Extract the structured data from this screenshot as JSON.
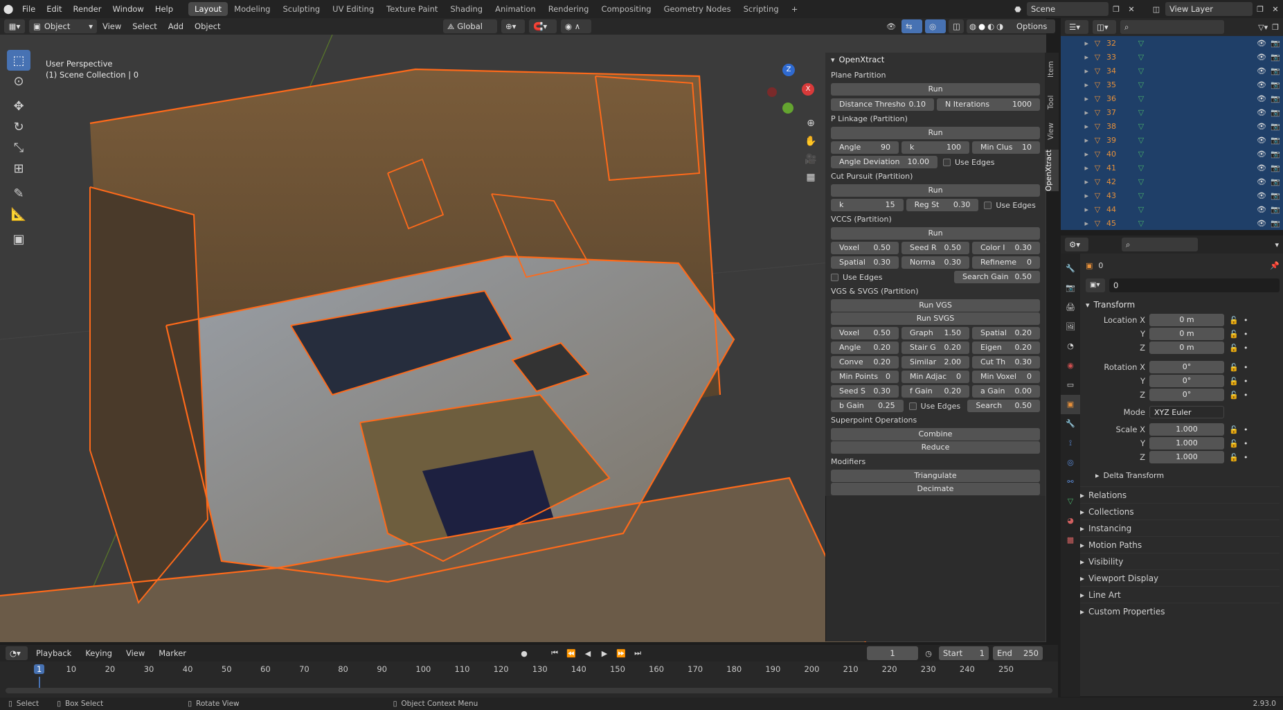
{
  "topbar": {
    "menus": [
      "File",
      "Edit",
      "Render",
      "Window",
      "Help"
    ],
    "workspaces": [
      "Layout",
      "Modeling",
      "Sculpting",
      "UV Editing",
      "Texture Paint",
      "Shading",
      "Animation",
      "Rendering",
      "Compositing",
      "Geometry Nodes",
      "Scripting"
    ],
    "active_workspace": "Layout",
    "scene": "Scene",
    "view_layer": "View Layer"
  },
  "viewport": {
    "mode": "Object Mode",
    "menus": [
      "View",
      "Select",
      "Add",
      "Object"
    ],
    "transform_orientation": "Global",
    "options_label": "Options",
    "overlay_title": "User Perspective",
    "overlay_sub": "(1) Scene Collection | 0"
  },
  "gizmo": {
    "z": "Z",
    "x": "X"
  },
  "npanel": {
    "tabs": [
      "Item",
      "Tool",
      "View",
      "OpenXtract"
    ],
    "title": "OpenXtract",
    "plane": {
      "heading": "Plane Partition",
      "run": "Run",
      "f1_label": "Distance Thresho",
      "f1_value": "0.10",
      "f2_label": "N Iterations",
      "f2_value": "1000"
    },
    "plink": {
      "heading": "P Linkage (Partition)",
      "run": "Run",
      "angle_l": "Angle",
      "angle_v": "90",
      "k_l": "k",
      "k_v": "100",
      "minclus_l": "Min Clus",
      "minclus_v": "10",
      "angdev_l": "Angle Deviation",
      "angdev_v": "10.00",
      "edges": "Use Edges"
    },
    "cut": {
      "heading": "Cut Pursuit (Partition)",
      "run": "Run",
      "k_l": "k",
      "k_v": "15",
      "reg_l": "Reg St",
      "reg_v": "0.30",
      "edges": "Use Edges"
    },
    "vccs": {
      "heading": "VCCS (Partition)",
      "run": "Run",
      "f": [
        [
          "Voxel",
          "0.50"
        ],
        [
          "Seed R",
          "0.50"
        ],
        [
          "Color I",
          "0.30"
        ],
        [
          "Spatial",
          "0.30"
        ],
        [
          "Norma",
          "0.30"
        ],
        [
          "Refineme",
          "0"
        ]
      ],
      "edges": "Use Edges",
      "sg_l": "Search Gain",
      "sg_v": "0.50"
    },
    "vgs": {
      "heading": "VGS & SVGS (Partition)",
      "run1": "Run VGS",
      "run2": "Run SVGS",
      "f": [
        [
          "Voxel",
          "0.50"
        ],
        [
          "Graph",
          "1.50"
        ],
        [
          "Spatial",
          "0.20"
        ],
        [
          "Angle",
          "0.20"
        ],
        [
          "Stair G",
          "0.20"
        ],
        [
          "Eigen",
          "0.20"
        ],
        [
          "Conve",
          "0.20"
        ],
        [
          "Similar",
          "2.00"
        ],
        [
          "Cut Th",
          "0.30"
        ],
        [
          "Min Points",
          "0"
        ],
        [
          "Min Adjac",
          "0"
        ],
        [
          "Min Voxel",
          "0"
        ],
        [
          "Seed S",
          "0.30"
        ],
        [
          "f Gain",
          "0.20"
        ],
        [
          "a Gain",
          "0.00"
        ]
      ],
      "bgain_l": "b Gain",
      "bgain_v": "0.25",
      "edges": "Use Edges",
      "search_l": "Search",
      "search_v": "0.50"
    },
    "superpoint": {
      "heading": "Superpoint Operations",
      "combine": "Combine",
      "reduce": "Reduce"
    },
    "modifiers": {
      "heading": "Modifiers",
      "triangulate": "Triangulate",
      "decimate": "Decimate"
    }
  },
  "outliner": {
    "items": [
      "32",
      "33",
      "34",
      "35",
      "36",
      "37",
      "38",
      "39",
      "40",
      "41",
      "42",
      "43",
      "44",
      "45"
    ]
  },
  "properties": {
    "object_name": "0",
    "data_name": "0",
    "transform": "Transform",
    "loc_label": "Location X",
    "y": "Y",
    "z": "Z",
    "loc": [
      "0 m",
      "0 m",
      "0 m"
    ],
    "rot_label": "Rotation X",
    "rot": [
      "0°",
      "0°",
      "0°"
    ],
    "mode_label": "Mode",
    "mode_value": "XYZ Euler",
    "scale_label": "Scale X",
    "scale": [
      "1.000",
      "1.000",
      "1.000"
    ],
    "delta": "Delta Transform",
    "panels": [
      "Relations",
      "Collections",
      "Instancing",
      "Motion Paths",
      "Visibility",
      "Viewport Display",
      "Line Art",
      "Custom Properties"
    ]
  },
  "timeline": {
    "menus": [
      "Playback",
      "Keying",
      "View",
      "Marker"
    ],
    "current_frame": "1",
    "start_label": "Start",
    "start": "1",
    "end_label": "End",
    "end": "250",
    "ticks": [
      "1",
      "10",
      "20",
      "30",
      "40",
      "50",
      "60",
      "70",
      "80",
      "90",
      "100",
      "110",
      "120",
      "130",
      "140",
      "150",
      "160",
      "170",
      "180",
      "190",
      "200",
      "210",
      "220",
      "230",
      "240",
      "250"
    ]
  },
  "status": {
    "select": "Select",
    "box_select": "Box Select",
    "rotate": "Rotate View",
    "context": "Object Context Menu",
    "version": "2.93.0"
  },
  "colors": {
    "accent": "#4772b3",
    "outline": "#ff6a1a",
    "selected_row": "#1f3f68"
  }
}
